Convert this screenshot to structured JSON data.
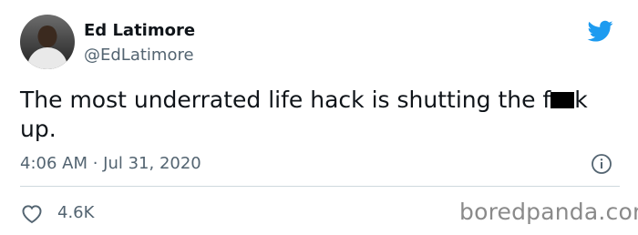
{
  "author": {
    "name": "Ed Latimore",
    "handle": "@EdLatimore"
  },
  "tweet": {
    "text_before": "The most underrated life hack is shutting the f",
    "text_after": "k up.",
    "timestamp": "4:06 AM · Jul 31, 2020"
  },
  "engagement": {
    "likes": "4.6K"
  },
  "watermark": "boredpanda.com",
  "icons": {
    "brand": "twitter-bird-icon",
    "info": "info-icon",
    "like": "heart-icon"
  },
  "colors": {
    "twitter_blue": "#1d9bf0",
    "secondary_text": "#536471",
    "divider": "#cfd9de"
  }
}
